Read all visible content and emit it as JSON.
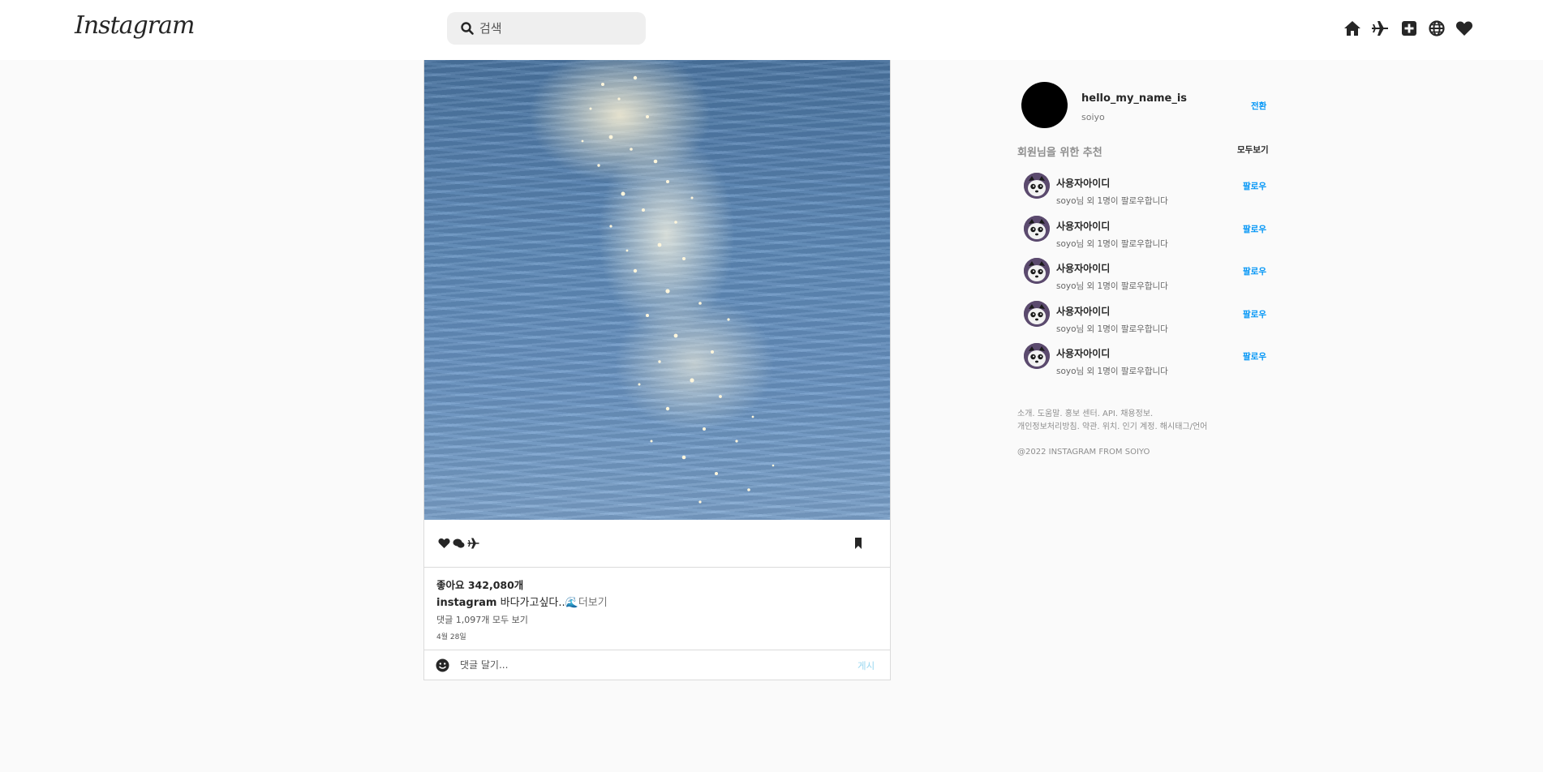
{
  "header": {
    "logo": "Instagram",
    "search_placeholder": "검색",
    "nav_icons": [
      "home-icon",
      "paper-plane-icon",
      "add-post-icon",
      "explore-icon",
      "heart-icon"
    ]
  },
  "post": {
    "likes": "좋아요 342,080개",
    "caption_user": "instagram",
    "caption_text": "바다가고싶다..🌊",
    "more": "더보기",
    "view_comments": "댓글 1,097개 모두 보기",
    "date": "4월 28일",
    "comment_placeholder": "댓글 달기...",
    "post_button": "게시"
  },
  "sidebar": {
    "username": "hello_my_name_is",
    "name": "soiyo",
    "switch_label": "전환",
    "recommend_title": "회원님을 위한 추천",
    "see_all": "모두보기",
    "suggestions": [
      {
        "id": "사용자아이디",
        "sub": "soyo님 외 1명이 팔로우합니다",
        "follow": "팔로우"
      },
      {
        "id": "사용자아이디",
        "sub": "soyo님 외 1명이 팔로우합니다",
        "follow": "팔로우"
      },
      {
        "id": "사용자아이디",
        "sub": "soyo님 외 1명이 팔로우합니다",
        "follow": "팔로우"
      },
      {
        "id": "사용자아이디",
        "sub": "soyo님 외 1명이 팔로우합니다",
        "follow": "팔로우"
      },
      {
        "id": "사용자아이디",
        "sub": "soyo님 외 1명이 팔로우합니다",
        "follow": "팔로우"
      }
    ],
    "footer_line1": "소개. 도움말. 홍보 센터. API. 채용정보.",
    "footer_line2": "개인정보처리방침. 약관. 위치. 인기 계정. 해시태그/언어",
    "copyright": "@2022 INSTAGRAM FROM SOIYO"
  }
}
